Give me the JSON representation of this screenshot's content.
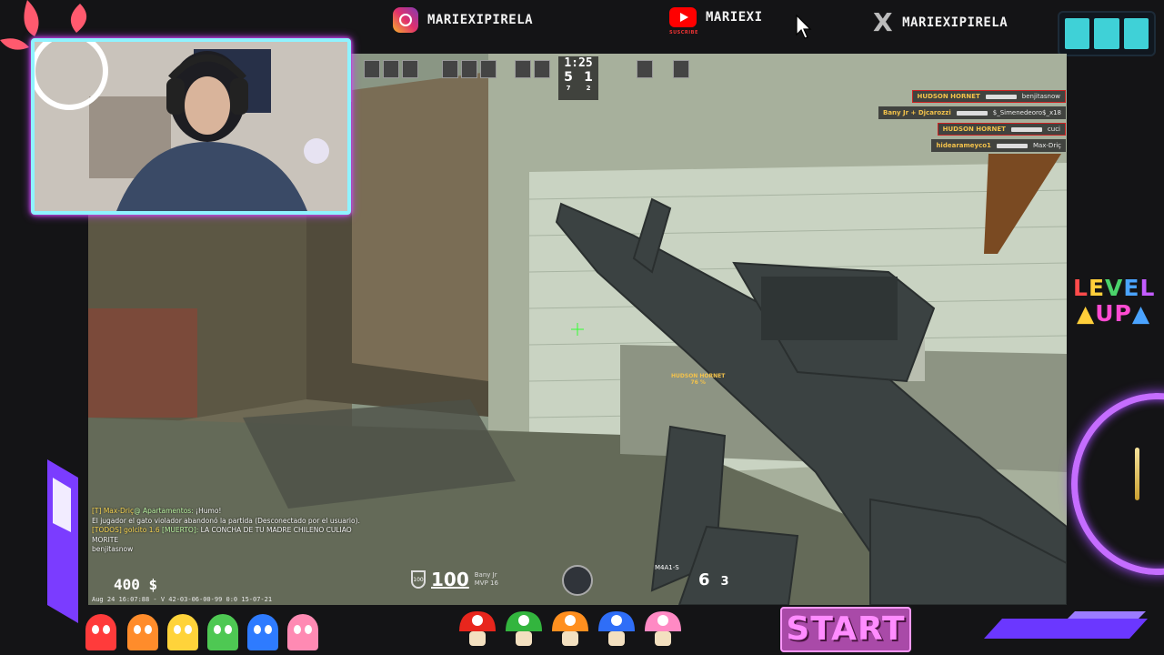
{
  "socials": {
    "instagram": "MARIEXIPIRELA",
    "youtube": "MARIEXI",
    "youtube_sub": "SUSCRIBE",
    "x": "MARIEXIPIRELA"
  },
  "hud": {
    "timer": "1:25",
    "score_ct": "5",
    "score_t": "1",
    "sub_ct": "7",
    "sub_t": "2",
    "money": "400 $",
    "health": "100",
    "armor": "100",
    "player_name": "Bany Jr",
    "player_sub": "MVP 16",
    "weapon": "M4A1-S",
    "ammo_clip": "6",
    "ammo_reserve": "3",
    "timestamp": "Aug 24 16:07:88 - V 42-03-06-00-99 0:0 15-07-21",
    "target_name": "HUDSON HORNET",
    "target_hp": "76 %"
  },
  "killfeed": [
    {
      "killer": "HUDSON HORNET",
      "victim": "benjitasnow",
      "highlight": true
    },
    {
      "killer": "Bany Jr + Djcarozzi",
      "victim": "$_Simenedeoro$_x18",
      "highlight": false
    },
    {
      "killer": "HUDSON HORNET",
      "victim": "cuci",
      "highlight": true
    },
    {
      "killer": "hidearameyco1",
      "victim": "Max-Driç",
      "highlight": false
    }
  ],
  "chat": [
    {
      "prefix": "[T] Max-Driç",
      "tag": "@ Apartamentos:",
      "text": " ¡Humo!"
    },
    {
      "prefix": "",
      "tag": "",
      "text": "El jugador el gato violador abandonó la partida (Desconectado por el usuario)."
    },
    {
      "prefix": "[TODOS] golcito 1.6",
      "tag": " [MUERTO]:",
      "text": " LA CONCHA DE TU MADRE CHILENO CULIAO"
    },
    {
      "prefix": "",
      "tag": "",
      "text": "MORITE"
    },
    {
      "prefix": "",
      "tag": "",
      "text": "benjitasnow"
    }
  ],
  "overlay": {
    "level_top": "LEVEL",
    "level_bottom": "UP",
    "start_label": "START"
  },
  "colors": {
    "neon_cyan": "#8ff3ff",
    "neon_purple": "#c56dff",
    "hud_yellow": "#f3c24b",
    "blocks_teal": "#3fd1d7"
  }
}
